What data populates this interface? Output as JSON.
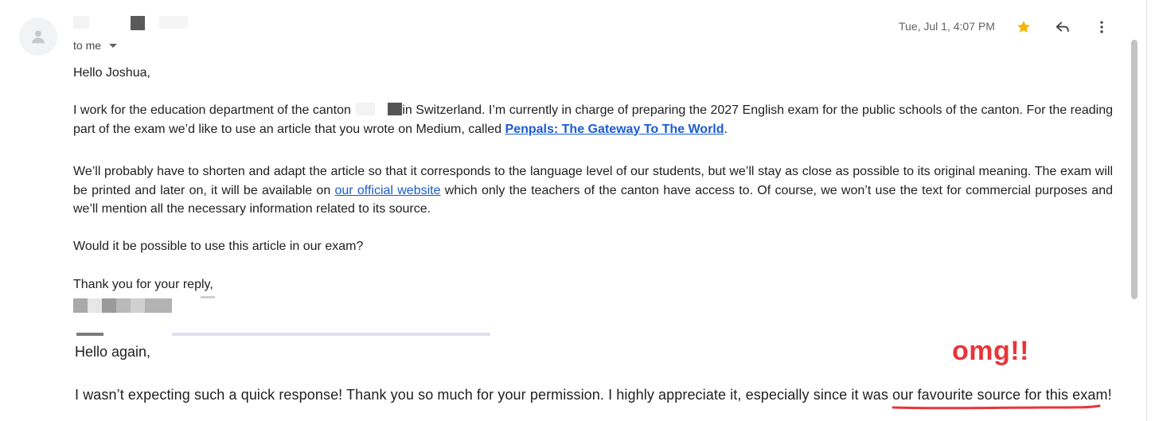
{
  "header": {
    "recipient_label": "to me",
    "timestamp": "Tue, Jul 1, 4:07 PM",
    "icons": {
      "avatar": "person-icon",
      "star": "star-icon",
      "reply": "reply-icon",
      "more": "more-vertical-icon"
    },
    "star_color": "#f4b400"
  },
  "email": {
    "greeting": "Hello Joshua,",
    "para1_a": "I work for the education department of the canton",
    "para1_b": "in Switzerland. I’m currently in charge of preparing the 2027 English exam for the public schools of the canton. For the reading part of the exam we’d like to use an article that you wrote on Medium, called",
    "article_link": "Penpals: The Gateway To The World",
    "para1_end": ".",
    "para2_a": "We’ll probably have to shorten and adapt the article so that it corresponds to the language level of our students, but we’ll stay as close as possible to its original meaning. The exam will be printed and later on, it will be available on",
    "website_link": "our official website",
    "para2_b": "which only the teachers of the canton have access to. Of course, we won’t use the text for commercial purposes and we’ll mention all the necessary information related to its source.",
    "para3": "Would it be possible to use this article in our exam?",
    "signoff": "Thank you for your reply,",
    "link_color": "#1a5cd2"
  },
  "reply": {
    "greeting": "Hello again,",
    "line": "I wasn’t expecting such a quick response!  Thank you so much for your permission. I highly appreciate it, especially since it was our favourite source for this exam!"
  },
  "annotation": {
    "text": "omg!!",
    "color": "#e8353a"
  }
}
